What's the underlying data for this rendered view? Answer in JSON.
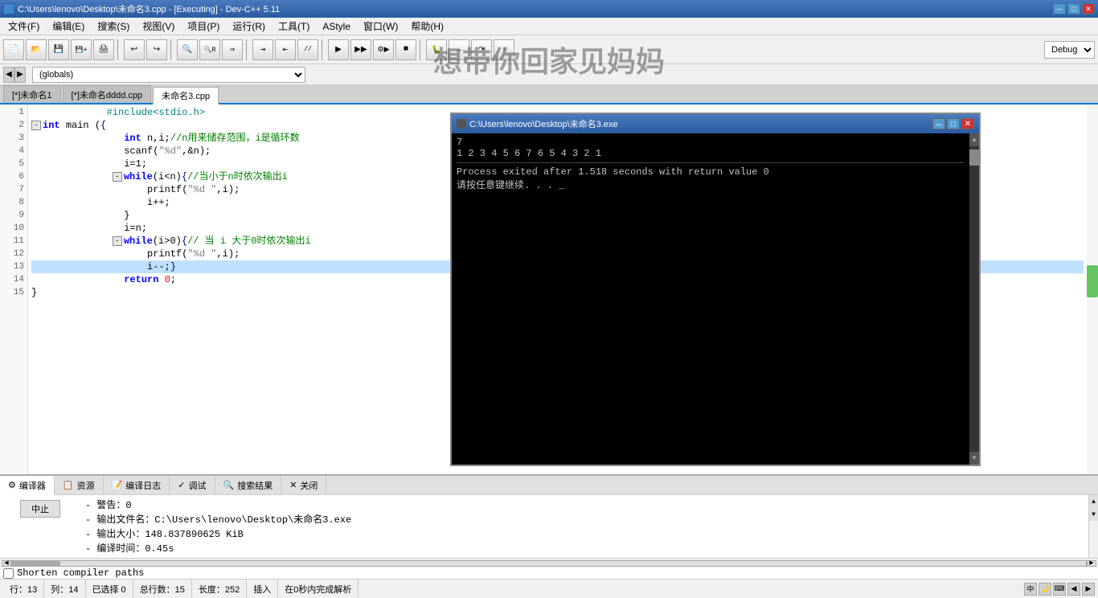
{
  "titleBar": {
    "title": "C:\\Users\\lenovo\\Desktop\\未命名3.cpp - [Executing] - Dev-C++ 5.11",
    "minimize": "－",
    "maximize": "□",
    "close": "✕"
  },
  "menuBar": {
    "items": [
      "文件(F)",
      "编辑(E)",
      "搜索(S)",
      "视图(V)",
      "项目(P)",
      "运行(R)",
      "工具(T)",
      "AStyle",
      "窗口(W)",
      "帮助(H)"
    ]
  },
  "toolbar": {
    "debugSelect": "Debug"
  },
  "globalsBar": {
    "value": "(globals)"
  },
  "tabs": {
    "items": [
      {
        "label": "[*]未命名1",
        "active": false
      },
      {
        "label": "[*]未命名dddd.cpp",
        "active": false
      },
      {
        "label": "未命名3.cpp",
        "active": true
      }
    ]
  },
  "editor": {
    "lines": [
      {
        "num": 1,
        "code": "#include<stdio.h>",
        "type": "normal"
      },
      {
        "num": 2,
        "code": "int main (){",
        "type": "fold"
      },
      {
        "num": 3,
        "code": "    int n,i;//n用来储存范围，i是循环数",
        "type": "normal"
      },
      {
        "num": 4,
        "code": "    scanf(\"%d\",&n);",
        "type": "normal"
      },
      {
        "num": 5,
        "code": "    i=1;",
        "type": "normal"
      },
      {
        "num": 6,
        "code": "    while(i<n){//当小于n时依次输出i",
        "type": "fold"
      },
      {
        "num": 7,
        "code": "        printf(\"%d \",i);",
        "type": "normal"
      },
      {
        "num": 8,
        "code": "        i++;",
        "type": "normal"
      },
      {
        "num": 9,
        "code": "    }",
        "type": "normal"
      },
      {
        "num": 10,
        "code": "    i=n;",
        "type": "normal"
      },
      {
        "num": 11,
        "code": "    while(i>0){// 当 i 大于0时依次输出i",
        "type": "fold"
      },
      {
        "num": 12,
        "code": "        printf(\"%d \",i);",
        "type": "normal"
      },
      {
        "num": 13,
        "code": "        i--;}",
        "type": "highlighted"
      },
      {
        "num": 14,
        "code": "    return 0;",
        "type": "normal"
      },
      {
        "num": 15,
        "code": "}",
        "type": "normal"
      }
    ]
  },
  "consoleWindow": {
    "title": "C:\\Users\\lenovo\\Desktop\\未命名3.exe",
    "line1": "7",
    "line2": "1 2 3 4 5 6 7 6 5 4 3 2 1",
    "separator": "────────────────────────────────",
    "line3": "Process exited after 1.518 seconds with return value 0",
    "line4": "请按任意键继续. . . _"
  },
  "bottomTabs": {
    "items": [
      "编译器",
      "资源",
      "编译日志",
      "调试",
      "搜索结果",
      "关闭"
    ]
  },
  "bottomOutput": {
    "lines": [
      "- 警告：0",
      "- 输出文件名：C:\\Users\\lenovo\\Desktop\\未命名3.exe",
      "- 输出大小：148.837890625 KiB",
      "- 编译时间：0.45s"
    ]
  },
  "stopButton": {
    "label": "中止"
  },
  "shortenPaths": {
    "label": "Shorten compiler paths"
  },
  "statusBar": {
    "row": "行：13",
    "col": "列：14",
    "sel": "已选择  0",
    "total": "总行数：15",
    "len": "长度：252",
    "insert": "插入",
    "parse": "在0秒内完成解析"
  },
  "watermark": "想带你回家见妈妈"
}
